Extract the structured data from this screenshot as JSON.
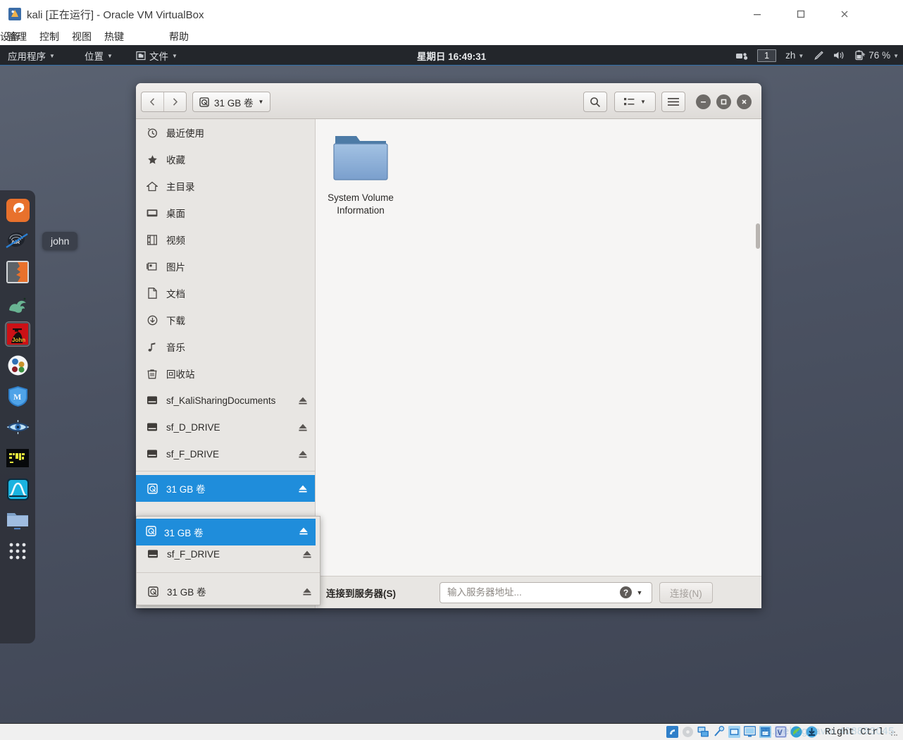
{
  "host_window": {
    "title": "kali [正在运行] - Oracle VM VirtualBox",
    "icon": "virtualbox-vm-icon",
    "controls": {
      "minimize": "minimize-icon",
      "maximize": "maximize-icon",
      "close": "close-icon"
    },
    "menus": [
      {
        "label": "管理"
      },
      {
        "label": "控制"
      },
      {
        "label": "视图"
      },
      {
        "label": "热键"
      },
      {
        "label": "设备"
      },
      {
        "label": "帮助"
      }
    ]
  },
  "status_bar": {
    "host_key": "Right Ctrl",
    "indicators": [
      "hdd-icon",
      "optical-disc-icon",
      "network-icon",
      "usb-icon",
      "shared-folder-icon",
      "display-icon",
      "recording-icon",
      "virtualization-icon",
      "mouse-integration-icon",
      "keyboard-icon"
    ],
    "watermark": "ps.wel.og..avoi 408893045"
  },
  "top_panel": {
    "applications": {
      "label": "应用程序",
      "caret": "chevron-down-icon"
    },
    "places": {
      "label": "位置",
      "caret": "chevron-down-icon"
    },
    "files": {
      "label": "文件",
      "icon": "files-app-icon",
      "caret": "chevron-down-icon"
    },
    "clock": "星期日 16:49:31",
    "right": {
      "screencast_icon": "screencast-icon",
      "workspace": "1",
      "input_source": {
        "label": "zh",
        "caret": "chevron-down-icon"
      },
      "tablet_icon": "stylus-icon",
      "volume_icon": "volume-icon",
      "battery_icon": "battery-charging-icon",
      "battery_percent": "76 %",
      "menu_caret": "chevron-down-icon"
    }
  },
  "dock": {
    "tooltip": "john",
    "items": [
      {
        "name": "firefox-esr",
        "icon": "firefox-icon",
        "selected": false
      },
      {
        "name": "aircrack-ng",
        "icon": "aircrack-icon",
        "selected": false
      },
      {
        "name": "burpsuite",
        "icon": "burpsuite-icon",
        "selected": false
      },
      {
        "name": "sqlmap",
        "icon": "sqlmap-hydra-icon",
        "selected": false
      },
      {
        "name": "john-the-ripper",
        "icon": "john-ripper-icon",
        "selected": true
      },
      {
        "name": "beef",
        "icon": "beef-icon",
        "selected": false
      },
      {
        "name": "metasploit",
        "icon": "metasploit-icon",
        "selected": false
      },
      {
        "name": "maltego",
        "icon": "maltego-eye-icon",
        "selected": false
      },
      {
        "name": "terminal",
        "icon": "terminal-icon",
        "selected": false
      },
      {
        "name": "wireshark",
        "icon": "wireshark-icon",
        "selected": false
      },
      {
        "name": "files",
        "icon": "folder-icon",
        "selected": false
      },
      {
        "name": "show-applications",
        "icon": "app-grid-icon",
        "selected": false
      }
    ]
  },
  "file_manager": {
    "header": {
      "back_icon": "chevron-left-icon",
      "forward_icon": "chevron-right-icon",
      "path_button": {
        "label": "31 GB 卷",
        "icon": "drive-icon",
        "caret": "chevron-down-icon"
      },
      "search_icon": "search-icon",
      "view_mode_icon": "list-view-icon",
      "view_mode_caret": "chevron-down-icon",
      "menu_icon": "hamburger-menu-icon",
      "window_minimize_icon": "minimize-icon",
      "window_maximize_icon": "maximize-icon",
      "window_close_icon": "close-icon"
    },
    "sidebar": [
      {
        "label": "最近使用",
        "icon": "clock-history-icon",
        "eject": false,
        "active": false
      },
      {
        "label": "收藏",
        "icon": "star-icon",
        "eject": false,
        "active": false
      },
      {
        "label": "主目录",
        "icon": "home-icon",
        "eject": false,
        "active": false
      },
      {
        "label": "桌面",
        "icon": "desktop-icon",
        "eject": false,
        "active": false
      },
      {
        "label": "视频",
        "icon": "film-icon",
        "eject": false,
        "active": false
      },
      {
        "label": "图片",
        "icon": "image-icon",
        "eject": false,
        "active": false
      },
      {
        "label": "文档",
        "icon": "document-icon",
        "eject": false,
        "active": false
      },
      {
        "label": "下载",
        "icon": "download-icon",
        "eject": false,
        "active": false
      },
      {
        "label": "音乐",
        "icon": "music-note-icon",
        "eject": false,
        "active": false
      },
      {
        "label": "回收站",
        "icon": "trash-icon",
        "eject": false,
        "active": false
      },
      {
        "label": "sf_KaliSharingDocuments",
        "icon": "network-drive-icon",
        "eject": true,
        "active": false
      },
      {
        "label": "sf_D_DRIVE",
        "icon": "network-drive-icon",
        "eject": true,
        "active": false
      },
      {
        "label": "sf_F_DRIVE",
        "icon": "network-drive-icon",
        "eject": true,
        "active": false
      },
      {
        "label": "31 GB 卷",
        "icon": "drive-icon",
        "eject": true,
        "active": true
      }
    ],
    "sidebar_popup": [
      {
        "label": "sf_F_DRIVE",
        "icon": "network-drive-icon",
        "eject": true
      },
      {
        "label": "31 GB 卷",
        "icon": "drive-icon",
        "eject": true
      }
    ],
    "dragged_row": {
      "label": "31 GB 卷",
      "icon": "drive-icon",
      "eject": true
    },
    "files": [
      {
        "name": "System Volume Information",
        "icon": "folder-icon"
      }
    ],
    "connect": {
      "label": "连接到服务器(S)",
      "placeholder": "输入服务器地址...",
      "value": "",
      "help_icon": "help-icon",
      "dropdown_icon": "chevron-down-icon",
      "button_label": "连接(N)"
    }
  },
  "colors": {
    "selection_blue": "#1f8ddb",
    "panel_dark": "#23262b",
    "desktop_top": "#5b6372",
    "desktop_bottom": "#3e4453",
    "folder_blue": "#8cb0d9"
  }
}
